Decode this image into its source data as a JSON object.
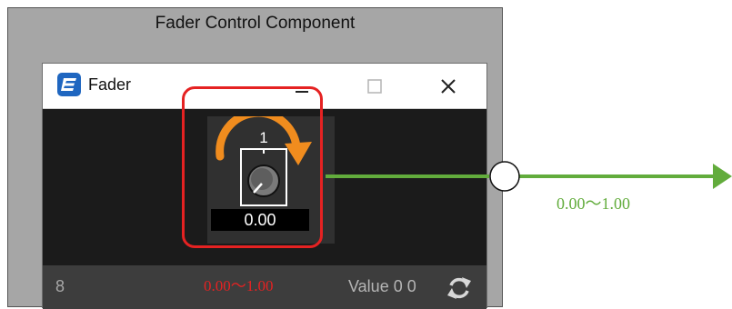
{
  "frame": {
    "title": "Fader Control Component"
  },
  "window": {
    "title": "Fader",
    "icon": "app-logo-icon",
    "controls": {
      "minimize": "minimize-icon",
      "maximize": "maximize-icon",
      "close": "close-icon"
    }
  },
  "component": {
    "channel_number": "1",
    "value": "0.00",
    "icon": "knob-icon",
    "arrow_icon": "rotate-arrow-icon"
  },
  "status_bar": {
    "left_text": "8",
    "range_label": "0.00～1.00",
    "value_label": "Value 0 0",
    "refresh_icon": "refresh-icon"
  },
  "output": {
    "range_label": "0.00～1.00",
    "arrow_icon": "arrow-right-icon"
  },
  "colors": {
    "frame_bg": "#a6a6a6",
    "window_bg": "#1b1b1b",
    "highlight": "#e52222",
    "connector": "#62ac3c",
    "arrow": "#f08c1e",
    "app_icon": "#1f66c0"
  }
}
